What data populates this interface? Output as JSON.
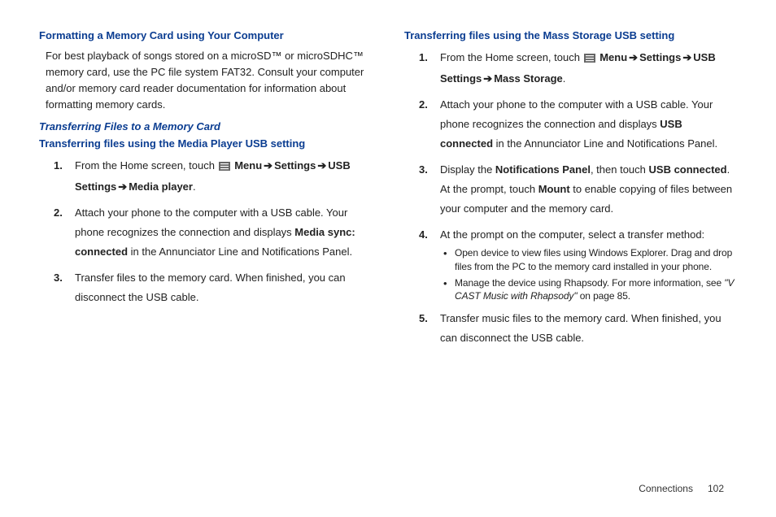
{
  "left": {
    "h1": "Formatting a Memory Card using Your Computer",
    "p1": "For best playback of songs stored on a microSD™ or microSDHC™ memory card, use the PC file system FAT32. Consult your computer and/or memory card reader documentation for information about formatting memory cards.",
    "h2": "Transferring Files to a Memory Card",
    "h3": "Transferring files using the Media Player USB setting",
    "step1a": "From the Home screen, touch ",
    "step1b_menu": "Menu",
    "step1c_settings": "Settings",
    "step1d_usb": "USB Settings",
    "step1e_media": "Media player",
    "step2a": "Attach your phone to the computer with a USB cable. Your phone recognizes the connection and displays ",
    "step2b": "Media sync: connected",
    "step2c": " in the Annunciator Line and Notifications Panel.",
    "step3": "Transfer files to the memory card. When finished, you can disconnect the USB cable."
  },
  "right": {
    "h1": "Transferring files using the Mass Storage USB setting",
    "step1a": "From the Home screen, touch ",
    "step1b_menu": "Menu",
    "step1c_settings": "Settings",
    "step1d_usb": "USB Settings",
    "step1e_mass": "Mass Storage",
    "step2a": "Attach your phone to the computer with a USB cable. Your phone recognizes the connection and displays ",
    "step2b": "USB connected",
    "step2c": " in the Annunciator Line and Notifications Panel.",
    "step3a": "Display the ",
    "step3b": "Notifications Panel",
    "step3c": ", then touch ",
    "step3d": "USB connected",
    "step3e": ". At the prompt, touch ",
    "step3f": "Mount",
    "step3g": " to enable copying of files between your computer and the memory card.",
    "step4": "At the prompt on the computer, select a transfer method:",
    "bullet1": "Open device to view files using Windows Explorer. Drag and drop files from the PC to the memory card installed in your phone.",
    "bullet2a": "Manage the device using Rhapsody. For more information, see ",
    "bullet2b": "\"V CAST Music with Rhapsody\"",
    "bullet2c": " on page 85.",
    "step5": "Transfer music files to the memory card. When finished, you can disconnect the USB cable."
  },
  "footer": {
    "section": "Connections",
    "page": "102"
  },
  "arrow": "➔"
}
